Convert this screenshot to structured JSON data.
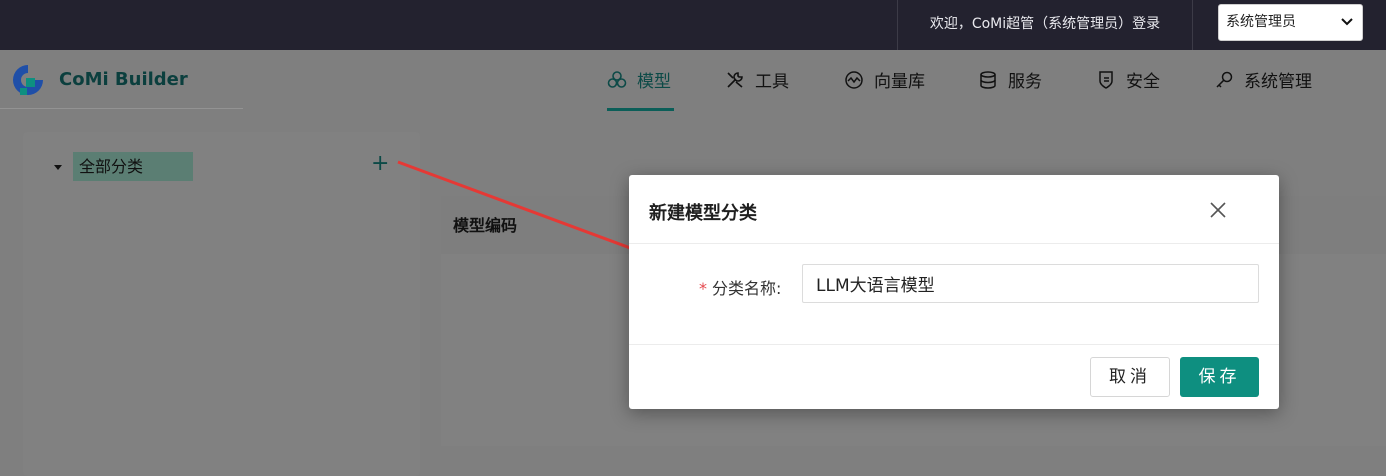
{
  "topbar": {
    "welcome_text": "欢迎，CoMi超管（系统管理员）登录",
    "role_select": {
      "value": "系统管理员"
    }
  },
  "brand": {
    "name": "CoMi Builder"
  },
  "nav": {
    "items": [
      {
        "label": "模型",
        "icon": "model-icon",
        "active": true
      },
      {
        "label": "工具",
        "icon": "tools-icon",
        "active": false
      },
      {
        "label": "向量库",
        "icon": "vector-icon",
        "active": false
      },
      {
        "label": "服务",
        "icon": "database-icon",
        "active": false
      },
      {
        "label": "安全",
        "icon": "shield-icon",
        "active": false
      },
      {
        "label": "系统管理",
        "icon": "key-icon",
        "active": false
      }
    ]
  },
  "sidebar": {
    "tree_root_label": "全部分类",
    "add_label": "+"
  },
  "table": {
    "columns": [
      "模型编码"
    ]
  },
  "modal": {
    "title": "新建模型分类",
    "field_label": "分类名称:",
    "required_mark": "*",
    "field_value": "LLM大语言模型",
    "cancel_label": "取消",
    "save_label": "保存"
  },
  "colors": {
    "topbar_bg": "#23222f",
    "accent": "#0e8f80",
    "annotation_arrow": "#e53935"
  }
}
